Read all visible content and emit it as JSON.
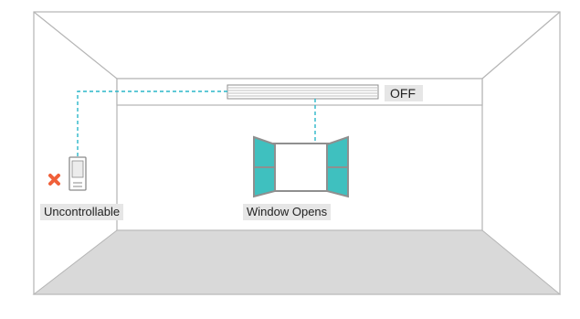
{
  "ac_unit": {
    "status_label": "OFF"
  },
  "remote": {
    "label": "Uncontrollable",
    "status_icon": "x-mark-icon"
  },
  "window": {
    "label": "Window Opens"
  },
  "colors": {
    "wall_line": "#b5b5b5",
    "floor": "#d9d9d9",
    "connector": "#2ab7c9",
    "window_pane": "#3fc0bf",
    "x_mark": "#f0603a",
    "label_bg": "#e6e6e6"
  }
}
